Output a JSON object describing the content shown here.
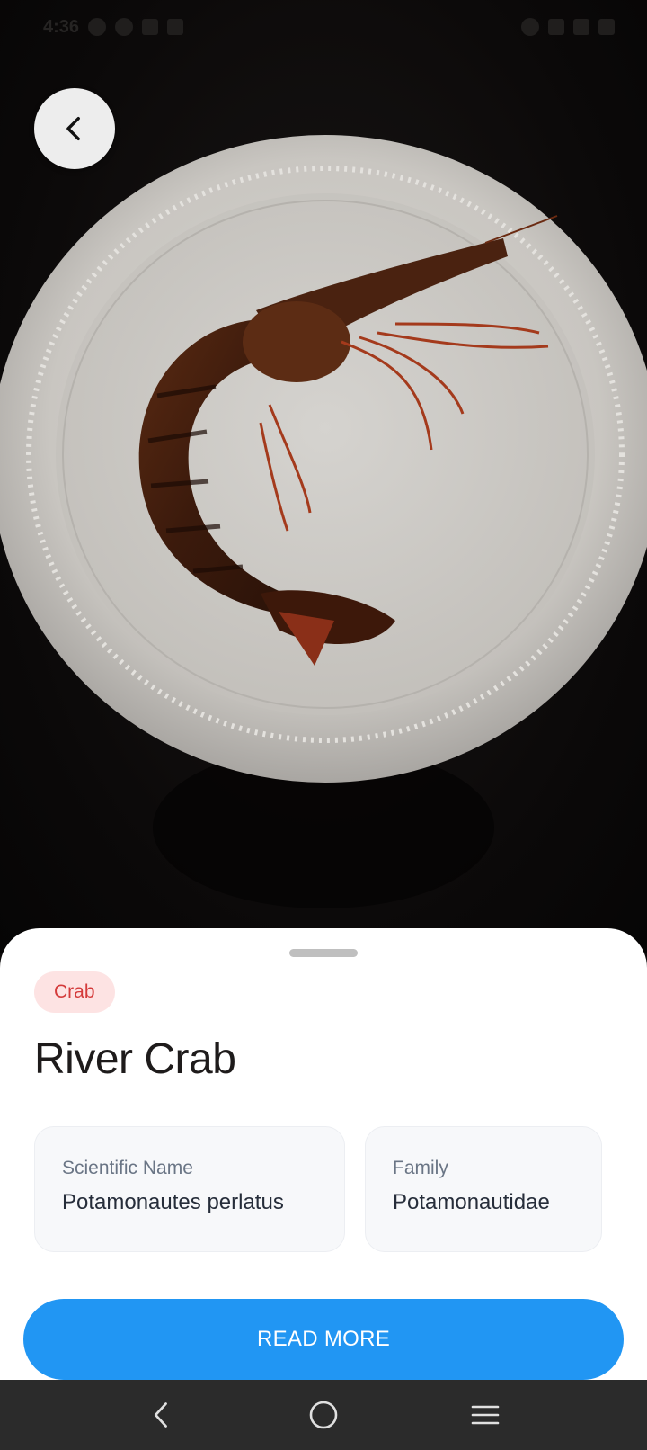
{
  "status_bar": {
    "time": "4:36"
  },
  "species": {
    "category": "Crab",
    "name": "River Crab",
    "scientific_name_label": "Scientific Name",
    "scientific_name": "Potamonautes perlatus",
    "family_label": "Family",
    "family": "Potamonautidae"
  },
  "actions": {
    "read_more": "READ MORE"
  },
  "icons": {
    "back": "chevron-left-icon",
    "nav_back": "nav-back-icon",
    "nav_home": "nav-home-icon",
    "nav_recents": "nav-recents-icon"
  },
  "colors": {
    "accent": "#2196f3",
    "chip_bg": "#fde3e3",
    "chip_text": "#d43b3b",
    "nav_bg": "#2b2b2b"
  }
}
